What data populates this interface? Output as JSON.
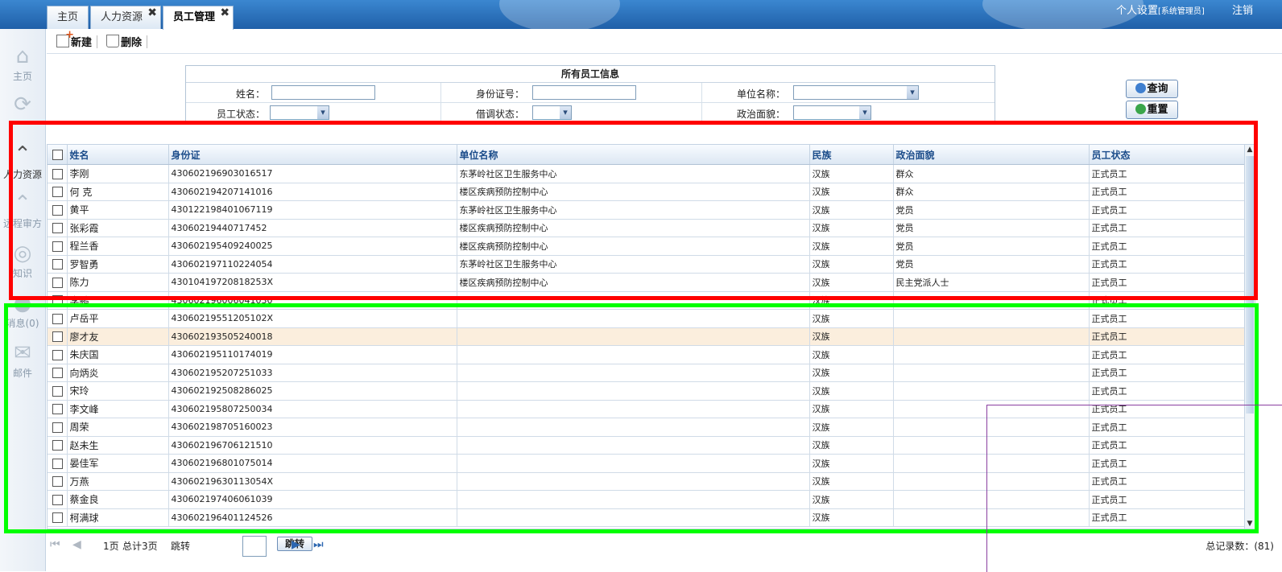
{
  "header": {
    "tabs": [
      {
        "label": "主页"
      },
      {
        "label": "人力资源",
        "close": "✖"
      },
      {
        "label": "员工管理",
        "close": "✖"
      }
    ],
    "settings_label": "个人设置",
    "role_label": "[系统管理员]",
    "logout_label": "注销"
  },
  "sidebar": {
    "items": [
      {
        "label": "主页",
        "icon": "home-icon"
      },
      {
        "label": "",
        "icon": "refresh-icon"
      },
      {
        "label": "人力资源",
        "icon": "people-icon"
      },
      {
        "label": "远程审方",
        "icon": "review-icon"
      },
      {
        "label": "知识",
        "icon": "knowledge-icon"
      },
      {
        "label": "消息(0)",
        "icon": "user-icon"
      },
      {
        "label": "邮件",
        "icon": "mail-icon"
      }
    ]
  },
  "toolbar": {
    "new_label": "新建",
    "delete_label": "删除"
  },
  "search": {
    "title": "所有员工信息",
    "name_label": "姓名：",
    "id_label": "身份证号：",
    "unit_label": "单位名称：",
    "status_label": "员工状态：",
    "loan_label": "借调状态：",
    "politics_label": "政治面貌：",
    "query_label": "查询",
    "reset_label": "重置"
  },
  "table": {
    "headers": [
      "姓名",
      "身份证",
      "单位名称",
      "民族",
      "政治面貌",
      "员工状态"
    ],
    "rows": [
      {
        "name": "李刚",
        "id": "430602196903016517",
        "unit": "东茅岭社区卫生服务中心",
        "nation": "汉族",
        "politics": "群众",
        "status": "正式员工"
      },
      {
        "name": "何 克",
        "id": "430602194207141016",
        "unit": "楼区疾病预防控制中心",
        "nation": "汉族",
        "politics": "群众",
        "status": "正式员工"
      },
      {
        "name": "黄平",
        "id": "430122198401067119",
        "unit": "东茅岭社区卫生服务中心",
        "nation": "汉族",
        "politics": "党员",
        "status": "正式员工"
      },
      {
        "name": "张彩霞",
        "id": "43060219440717452",
        "unit": "楼区疾病预防控制中心",
        "nation": "汉族",
        "politics": "党员",
        "status": "正式员工"
      },
      {
        "name": "程兰香",
        "id": "430602195409240025",
        "unit": "楼区疾病预防控制中心",
        "nation": "汉族",
        "politics": "党员",
        "status": "正式员工"
      },
      {
        "name": "罗智勇",
        "id": "430602197110224054",
        "unit": "东茅岭社区卫生服务中心",
        "nation": "汉族",
        "politics": "党员",
        "status": "正式员工"
      },
      {
        "name": "陈力",
        "id": "43010419720818253X",
        "unit": "楼区疾病预防控制中心",
        "nation": "汉族",
        "politics": "民主党派人士",
        "status": "正式员工"
      },
      {
        "name": "李鹏",
        "id": "430602196006041030",
        "unit": "",
        "nation": "汉族",
        "politics": "",
        "status": "正式员工"
      },
      {
        "name": "卢岳平",
        "id": "43060219551205102X",
        "unit": "",
        "nation": "汉族",
        "politics": "",
        "status": "正式员工"
      },
      {
        "name": "廖才友",
        "id": "430602193505240018",
        "unit": "",
        "nation": "汉族",
        "politics": "",
        "status": "正式员工"
      },
      {
        "name": "朱庆国",
        "id": "430602195110174019",
        "unit": "",
        "nation": "汉族",
        "politics": "",
        "status": "正式员工"
      },
      {
        "name": "向炳炎",
        "id": "430602195207251033",
        "unit": "",
        "nation": "汉族",
        "politics": "",
        "status": "正式员工"
      },
      {
        "name": "宋玲",
        "id": "430602192508286025",
        "unit": "",
        "nation": "汉族",
        "politics": "",
        "status": "正式员工"
      },
      {
        "name": "李文峰",
        "id": "430602195807250034",
        "unit": "",
        "nation": "汉族",
        "politics": "",
        "status": "正式员工"
      },
      {
        "name": "周荣",
        "id": "430602198705160023",
        "unit": "",
        "nation": "汉族",
        "politics": "",
        "status": "正式员工"
      },
      {
        "name": "赵未生",
        "id": "430602196706121510",
        "unit": "",
        "nation": "汉族",
        "politics": "",
        "status": "正式员工"
      },
      {
        "name": "晏佳军",
        "id": "430602196801075014",
        "unit": "",
        "nation": "汉族",
        "politics": "",
        "status": "正式员工"
      },
      {
        "name": "万燕",
        "id": "43060219630113054X",
        "unit": "",
        "nation": "汉族",
        "politics": "",
        "status": "正式员工"
      },
      {
        "name": "蔡金良",
        "id": "430602197406061039",
        "unit": "",
        "nation": "汉族",
        "politics": "",
        "status": "正式员工"
      },
      {
        "name": "柯满球",
        "id": "430602196401124526",
        "unit": "",
        "nation": "汉族",
        "politics": "",
        "status": "正式员工"
      }
    ]
  },
  "pager": {
    "page_label": "1页",
    "total_pages_label": "总计3页",
    "jump_label": "跳转",
    "jump_button": "跳转",
    "total_records_label": "总记录数：(81)"
  },
  "colors": {
    "header_blue": "#1f5fa8",
    "highlight_row": "#fbeedd",
    "red_box": "#ff0000",
    "green_box": "#00ff00"
  }
}
